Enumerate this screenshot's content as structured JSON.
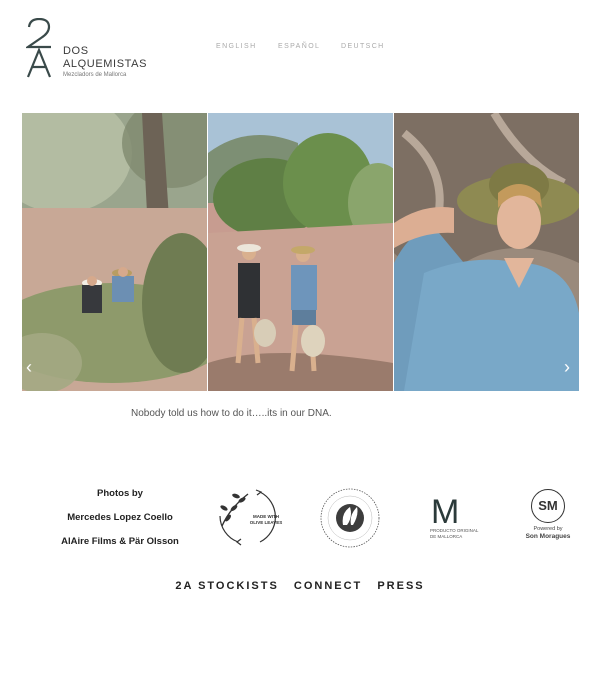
{
  "brand": {
    "mark": "2A",
    "name_line1": "DOS",
    "name_line2": "ALQUEMISTAS",
    "tagline": "Mezcladors de Mallorca"
  },
  "languages": [
    "ENGLISH",
    "ESPAÑOL",
    "DEUTSCH"
  ],
  "gallery": {
    "prev_icon": "chevron-left-icon",
    "next_icon": "chevron-right-icon"
  },
  "caption": "Nobody told us how to do it…..its in our DNA.",
  "credits": {
    "line1": "Photos by",
    "line2": "Mercedes Lopez Coello",
    "line3": "AlAire Films  & Pär Olsson"
  },
  "badges": {
    "olive_text1": "MADE WITH",
    "olive_text2": "OLIVE LEAVES",
    "producto_mark": "M",
    "producto_text1": "PRODUCTO ORIGINAL",
    "producto_text2": "DE MALLORCA",
    "sm_mark": "SM",
    "sm_text1": "Powered by",
    "sm_text2": "Son Moragues"
  },
  "footer_nav": [
    "2A STOCKISTS",
    "CONNECT",
    "PRESS"
  ]
}
